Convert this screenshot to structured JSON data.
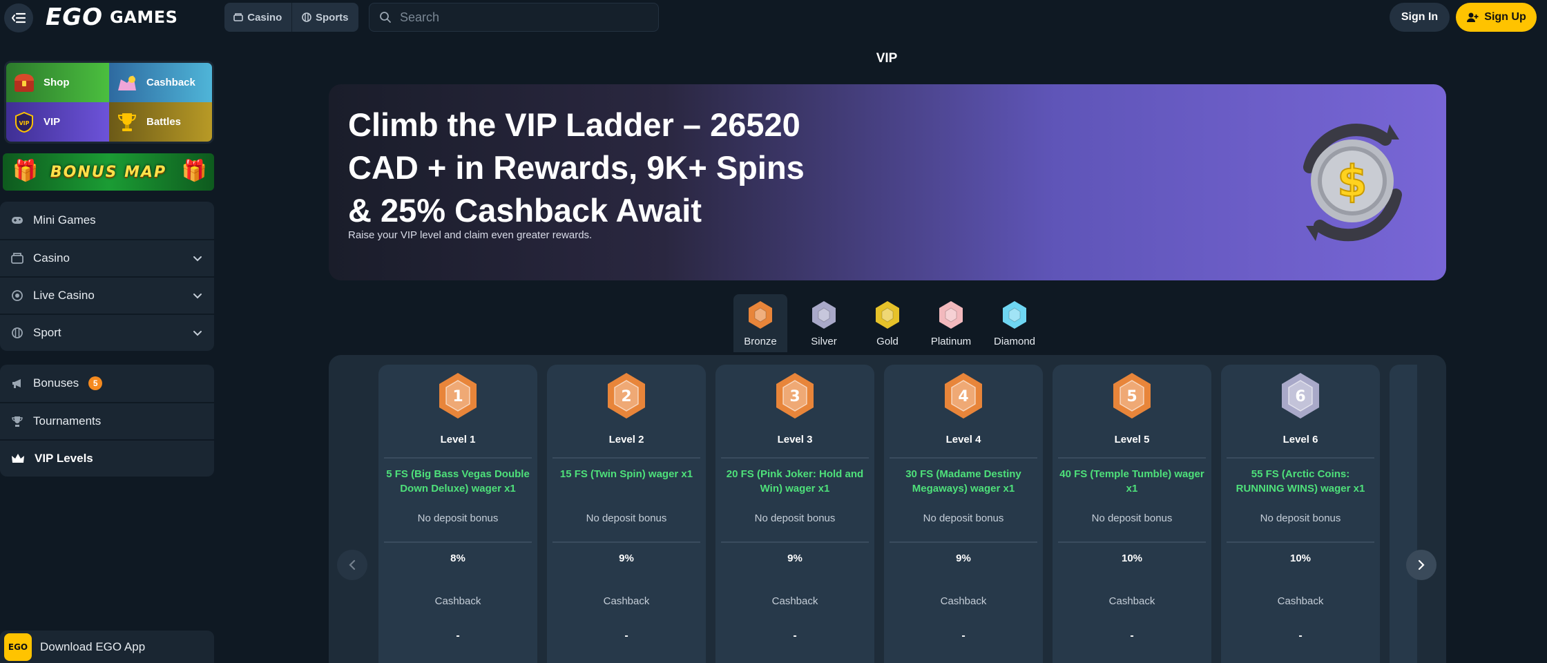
{
  "header": {
    "logo_main": "EGO",
    "logo_secondary": "GAMES",
    "categories": [
      {
        "label": "Casino",
        "icon": "casino-icon"
      },
      {
        "label": "Sports",
        "icon": "sports-ball-icon"
      }
    ],
    "search": {
      "placeholder": "Search"
    },
    "signin_label": "Sign In",
    "signup_label": "Sign Up"
  },
  "sidebar": {
    "promo_tiles": [
      {
        "label": "Shop",
        "icon": "treasure-chest-icon"
      },
      {
        "label": "Cashback",
        "icon": "cashback-icon"
      },
      {
        "label": "VIP",
        "icon": "vip-badge-icon"
      },
      {
        "label": "Battles",
        "icon": "trophy-icon"
      }
    ],
    "bonus_map_label": "BONUS MAP",
    "nav_main": [
      {
        "label": "Mini Games",
        "icon": "gamepad-icon",
        "has_chevron": false
      },
      {
        "label": "Casino",
        "icon": "casino-icon",
        "has_chevron": true
      },
      {
        "label": "Live Casino",
        "icon": "live-icon",
        "has_chevron": true
      },
      {
        "label": "Sport",
        "icon": "sports-ball-icon",
        "has_chevron": true
      }
    ],
    "nav_secondary": [
      {
        "label": "Bonuses",
        "icon": "megaphone-icon",
        "badge": "5"
      },
      {
        "label": "Tournaments",
        "icon": "trophy-icon"
      },
      {
        "label": "VIP Levels",
        "icon": "crown-icon",
        "active": true
      }
    ],
    "download_label": "Download EGO App",
    "download_logo": "EGO"
  },
  "page": {
    "title": "VIP",
    "hero": {
      "title": "Climb the VIP Ladder – 26520 CAD + in Rewards, 9K+ Spins & 25% Cashback Await",
      "subtitle": "Raise your VIP level and claim even greater rewards."
    },
    "tiers": [
      {
        "label": "Bronze",
        "color": "#e8853a",
        "active": true
      },
      {
        "label": "Silver",
        "color": "#a9a9c9"
      },
      {
        "label": "Gold",
        "color": "#e6c22a"
      },
      {
        "label": "Platinum",
        "color": "#f2b9bd"
      },
      {
        "label": "Diamond",
        "color": "#6fd6f2"
      }
    ],
    "levels": [
      {
        "number": "1",
        "name": "Level 1",
        "reward": "5 FS (Big Bass Vegas Double Down Deluxe) wager x1",
        "bonus_type": "No deposit bonus",
        "cashback": "8%",
        "cashback_label": "Cashback",
        "extra": "-",
        "color": "#e8853a"
      },
      {
        "number": "2",
        "name": "Level 2",
        "reward": "15 FS (Twin Spin) wager x1",
        "bonus_type": "No deposit bonus",
        "cashback": "9%",
        "cashback_label": "Cashback",
        "extra": "-",
        "color": "#e8853a"
      },
      {
        "number": "3",
        "name": "Level 3",
        "reward": "20 FS (Pink Joker: Hold and Win) wager x1",
        "bonus_type": "No deposit bonus",
        "cashback": "9%",
        "cashback_label": "Cashback",
        "extra": "-",
        "color": "#e8853a"
      },
      {
        "number": "4",
        "name": "Level 4",
        "reward": "30 FS (Madame Destiny Megaways) wager x1",
        "bonus_type": "No deposit bonus",
        "cashback": "9%",
        "cashback_label": "Cashback",
        "extra": "-",
        "color": "#e8853a"
      },
      {
        "number": "5",
        "name": "Level 5",
        "reward": "40 FS (Temple Tumble) wager x1",
        "bonus_type": "No deposit bonus",
        "cashback": "10%",
        "cashback_label": "Cashback",
        "extra": "-",
        "color": "#e8853a"
      },
      {
        "number": "6",
        "name": "Level 6",
        "reward": "55 FS (Arctic Coins: RUNNING WINS) wager x1",
        "bonus_type": "No deposit bonus",
        "cashback": "10%",
        "cashback_label": "Cashback",
        "extra": "-",
        "color": "#a9a9c9"
      }
    ]
  },
  "colors": {
    "accent": "#ffc300",
    "reward_green": "#4ee07a",
    "background": "#0f1923",
    "panel": "#1e2c39"
  }
}
